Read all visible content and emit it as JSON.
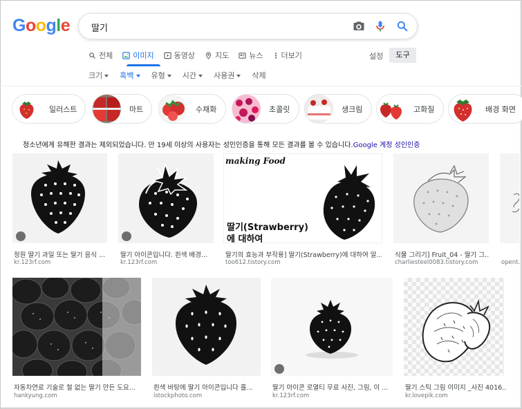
{
  "logo": {
    "letters": [
      "G",
      "o",
      "o",
      "g",
      "l",
      "e"
    ],
    "colors": [
      "#4285f4",
      "#ea4335",
      "#fbbc05",
      "#4285f4",
      "#34a853",
      "#ea4335"
    ]
  },
  "search": {
    "query": "딸기"
  },
  "tabs": [
    {
      "label": "전체",
      "icon": "search-icon"
    },
    {
      "label": "이미지",
      "icon": "image-icon",
      "active": true
    },
    {
      "label": "동영상",
      "icon": "video-icon"
    },
    {
      "label": "지도",
      "icon": "map-pin-icon"
    },
    {
      "label": "뉴스",
      "icon": "news-icon"
    },
    {
      "label": "더보기",
      "icon": "more-icon"
    }
  ],
  "settings_label": "설정",
  "tools_label": "도구",
  "filters": [
    {
      "label": "크기",
      "dropdown": true
    },
    {
      "label": "흑백",
      "dropdown": true,
      "active": true
    },
    {
      "label": "유형",
      "dropdown": true
    },
    {
      "label": "시간",
      "dropdown": true
    },
    {
      "label": "사용권",
      "dropdown": true
    },
    {
      "label": "삭제",
      "dropdown": false
    }
  ],
  "chips": [
    "일러스트",
    "마트",
    "수채화",
    "초콜릿",
    "생크림",
    "고화질",
    "배경 화면"
  ],
  "notice": {
    "text": "청소년에게 유해한 결과는 제외되었습니다. 만 19세 이상의 사용자는 성인인증을 통해 모든 결과를 볼 수 있습니다.",
    "link": "Google 계정 성인인증"
  },
  "results_row1": [
    {
      "caption": "정원 딸기 과일 또는 딸기 음식 ...",
      "source": "kr.123rf.com"
    },
    {
      "caption": "딸기 아이콘입니다. 흰색 배경...",
      "source": "kr.123rf.com"
    },
    {
      "caption": "딸기의 효능과 부작용] 딸기(Strawberry)에 대하여 알...",
      "source": "too612.tistory.com",
      "overlay_title": "making Food",
      "overlay_line1": "딸기(Strawberry)",
      "overlay_line2": "에 대하여"
    },
    {
      "caption": "식물 그리기] Fruit_04 - 딸기 그...",
      "source": "charliesteel0083.tistory.com"
    },
    {
      "caption": "",
      "source": "opent..."
    }
  ],
  "results_row2": [
    {
      "caption": "자동차연료 기술로 철 없는 딸기 만든 도요...",
      "source": "hankyung.com"
    },
    {
      "caption": "흰색 바탕에 딸기 아이콘입니다 흘...",
      "source": "istockphoto.com"
    },
    {
      "caption": "딸기 아이콘 로열티 무료 사진, 그림, 이 ...",
      "source": "kr.123rf.com"
    },
    {
      "caption": "딸기 스틱 그림 이미지 _사진 4016...",
      "source": "kr.lovepik.com"
    }
  ]
}
